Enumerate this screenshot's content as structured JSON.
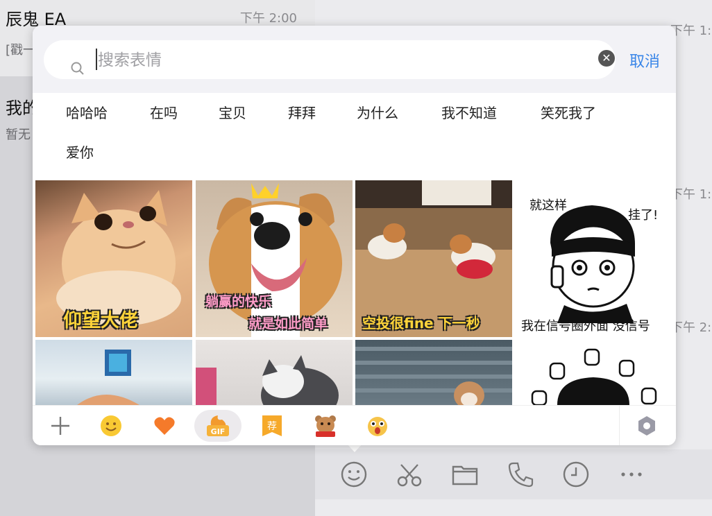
{
  "chat_list": {
    "items": [
      {
        "name": "辰鬼 EA",
        "time": "下午 2:00",
        "preview": "[戳一"
      },
      {
        "name": "我的",
        "time": "",
        "preview": "暂无"
      }
    ]
  },
  "right_times": [
    "下午 1:",
    "下午 1:",
    "下午 2:"
  ],
  "emoji_panel": {
    "search": {
      "placeholder": "搜索表情",
      "value": ""
    },
    "cancel_label": "取消",
    "tags": [
      "哈哈哈",
      "在吗",
      "宝贝",
      "拜拜",
      "为什么",
      "我不知道",
      "笑死我了",
      "爱你"
    ],
    "stickers": [
      {
        "caption": "仰望大佬"
      },
      {
        "caption_line1": "躺赢的快乐",
        "caption_line2": "就是如此简单"
      },
      {
        "caption": "空投很fine 下一秒"
      },
      {
        "text_top": "就这样",
        "text_right": "挂了!",
        "text_bottom": "我在信号圈外面 没信号"
      }
    ],
    "bottom_tabs": [
      {
        "icon": "plus-icon"
      },
      {
        "icon": "smiley-icon"
      },
      {
        "icon": "heart-icon"
      },
      {
        "icon": "gif-icon",
        "label": "GIF",
        "active": true
      },
      {
        "icon": "recommend-icon",
        "label": "荐"
      },
      {
        "icon": "bear-sticker-icon"
      },
      {
        "icon": "shocked-sticker-icon"
      },
      {
        "icon": "settings-icon"
      }
    ]
  },
  "toolbar": {
    "tools": [
      "emoji-icon",
      "scissors-icon",
      "folder-icon",
      "phone-icon",
      "clock-icon",
      "more-icon"
    ]
  },
  "colors": {
    "accent": "#3a86e8",
    "heart": "#f57a2a",
    "smiley": "#f9c933"
  }
}
